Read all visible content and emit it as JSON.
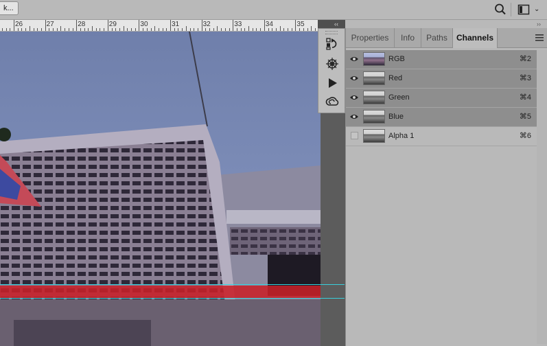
{
  "topbar": {
    "truncated_button_label": "k...",
    "search_icon": "search-icon",
    "workspace_icon": "workspace-icon",
    "workspace_dropdown": "⌄"
  },
  "ruler": {
    "labels": [
      "26",
      "27",
      "28",
      "29",
      "30",
      "31",
      "32",
      "33",
      "34",
      "35"
    ]
  },
  "mini_dock": {
    "collapse_glyph": "‹‹",
    "icons": [
      "history-icon",
      "brush-settings-icon",
      "play-action-icon",
      "creative-cloud-libraries-icon"
    ]
  },
  "panel": {
    "collapse_glyph": "››",
    "tabs": [
      "Properties",
      "Info",
      "Paths",
      "Channels"
    ],
    "active_tab": "Channels",
    "channels": [
      {
        "name": "RGB",
        "shortcut": "⌘2",
        "visible": true
      },
      {
        "name": "Red",
        "shortcut": "⌘3",
        "visible": true
      },
      {
        "name": "Green",
        "shortcut": "⌘4",
        "visible": true
      },
      {
        "name": "Blue",
        "shortcut": "⌘5",
        "visible": true
      },
      {
        "name": "Alpha 1",
        "shortcut": "⌘6",
        "visible": false
      }
    ]
  },
  "colors": {
    "selected_row": "#8e8e8e",
    "guide": "#38d0dc",
    "selection_overlay": "#c82028"
  }
}
